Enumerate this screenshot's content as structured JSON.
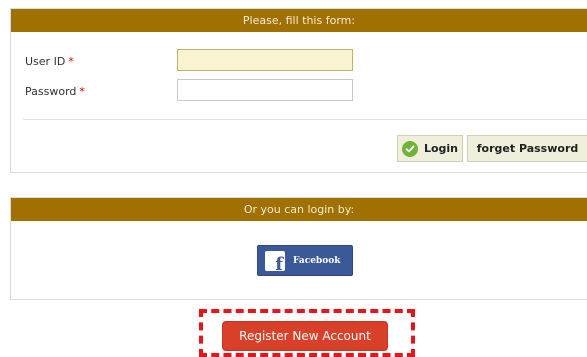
{
  "login_form": {
    "header": "Please, fill this form:",
    "user_id_label": "User ID",
    "password_label": "Password",
    "required_marker": "*",
    "user_id_value": "",
    "password_value": "",
    "login_label": "Login",
    "forget_password_label": "forget Password"
  },
  "social_login": {
    "header": "Or you can login by:",
    "facebook_label": "Facebook"
  },
  "register": {
    "label": "Register New Account"
  },
  "colors": {
    "header_bg": "#a07000",
    "facebook_blue": "#3b5998",
    "register_red": "#d9402a",
    "highlight_red": "#e8141a",
    "login_check_green": "#6fb33a"
  }
}
